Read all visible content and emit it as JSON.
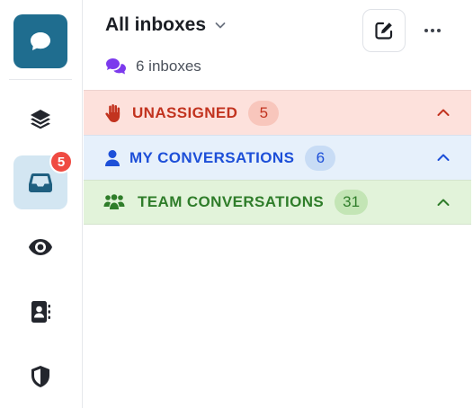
{
  "rail": {
    "items": [
      {
        "name": "conversations",
        "icon": "chat-bubble-icon"
      },
      {
        "name": "stack",
        "icon": "layers-icon"
      },
      {
        "name": "inbox",
        "icon": "inbox-tray-icon",
        "active": true,
        "badge": "5"
      },
      {
        "name": "views",
        "icon": "eye-icon"
      },
      {
        "name": "contacts",
        "icon": "address-book-icon"
      },
      {
        "name": "security",
        "icon": "shield-icon"
      }
    ]
  },
  "header": {
    "title": "All inboxes",
    "subtitle": "6 inboxes"
  },
  "sections": {
    "unassigned": {
      "label": "UNASSIGNED",
      "count": "5"
    },
    "mine": {
      "label": "MY CONVERSATIONS",
      "count": "6"
    },
    "team": {
      "label": "TEAM CONVERSATIONS",
      "count": "31"
    }
  },
  "colors": {
    "brand": "#1f6d8f",
    "badge": "#ef4b42",
    "unassigned": "#c2331f",
    "mine": "#1d4fd8",
    "team": "#2f7d2a"
  }
}
